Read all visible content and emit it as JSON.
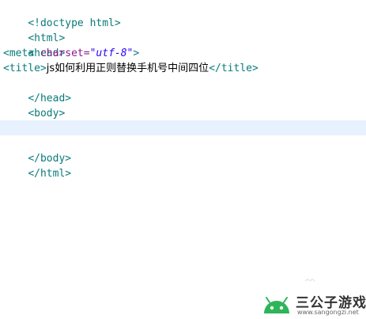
{
  "code": {
    "line1": "<!doctype html>",
    "line2": "<html>",
    "line3": "<head>",
    "line4": {
      "open": "<meta ",
      "attr": "charset=",
      "value": "\"utf-8\"",
      "close": ">"
    },
    "line5": {
      "open": "<title>",
      "text": "js如何利用正则替换手机号中间四位",
      "close": "</title>"
    },
    "line6": "</head>",
    "line7": "<body>",
    "line8": "</body>",
    "line9": "</html>"
  },
  "colors": {
    "tag": "#0a7a7a",
    "attr": "#8b1a8b",
    "string": "#2a00ff",
    "current_line": "#e8f2fe",
    "logo_green": "#2fb45a"
  },
  "decor": {
    "mark": "ᴖᴖ"
  },
  "watermark": {
    "site_name": "三公子游戏网",
    "url": "www.sangongzi.net",
    "icon": "android-logo-icon"
  }
}
